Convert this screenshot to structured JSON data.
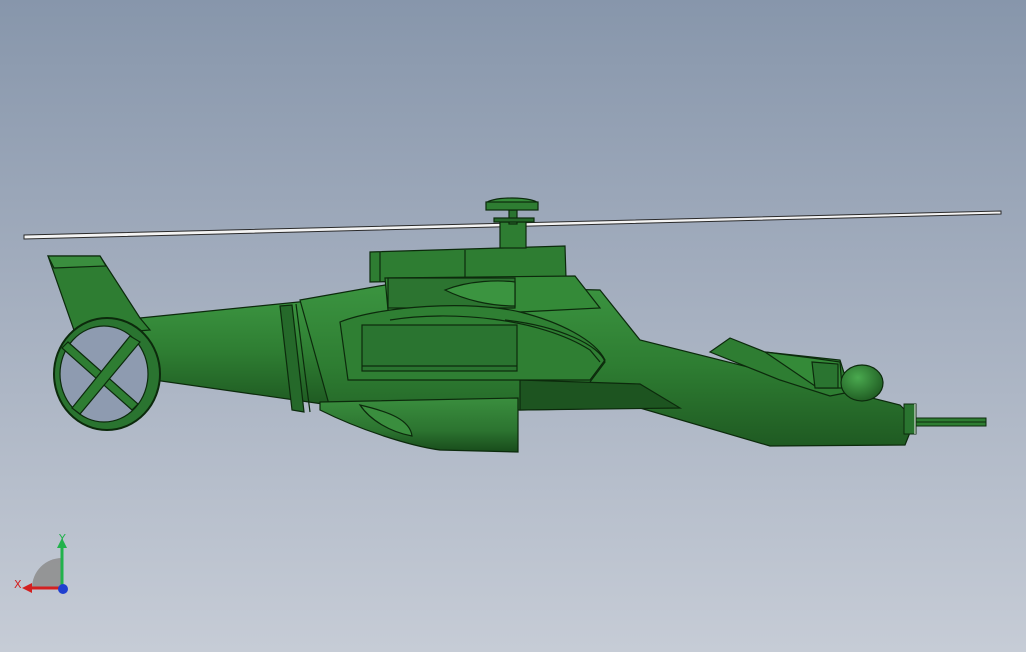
{
  "viewport": {
    "background_top": "#8796ab",
    "background_bottom": "#c6ccd6"
  },
  "model": {
    "part_color": "#2e7d32",
    "edge_color": "#0c2a0c",
    "shade_color": "#225e25",
    "highlight_color": "#3b9440",
    "blade_color": "#f2f2f2"
  },
  "triad": {
    "x_label": "X",
    "y_label": "Y",
    "x_color": "#d32020",
    "y_color": "#22b24c",
    "z_color": "#1f3fd0",
    "icon": "coordinate-axes-triad"
  }
}
